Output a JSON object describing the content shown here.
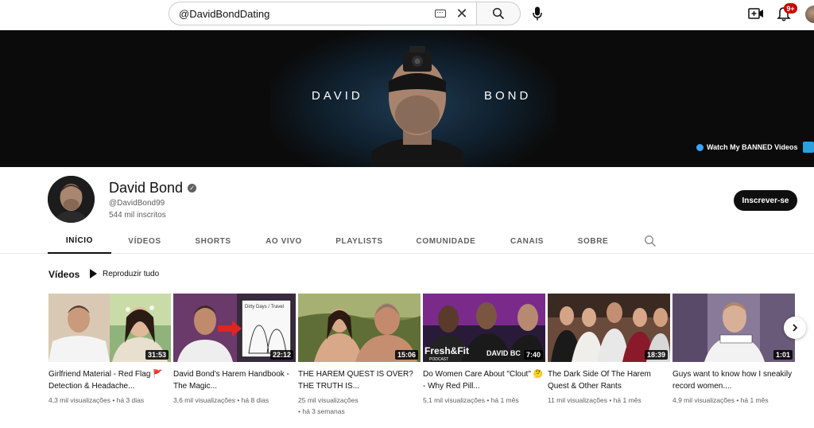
{
  "search": {
    "value": "@DavidBondDating"
  },
  "notifications": {
    "badge": "9+"
  },
  "banner": {
    "name_left": "DAVID",
    "name_right": "BOND",
    "link_label": "Watch My BANNED Videos"
  },
  "channel": {
    "name": "David Bond",
    "handle": "@DavidBond99",
    "subscribers": "544 mil inscritos",
    "subscribe_label": "Inscrever-se"
  },
  "tabs": [
    {
      "label": "INÍCIO",
      "active": true
    },
    {
      "label": "VÍDEOS"
    },
    {
      "label": "SHORTS"
    },
    {
      "label": "AO VIVO"
    },
    {
      "label": "PLAYLISTS"
    },
    {
      "label": "COMUNIDADE"
    },
    {
      "label": "CANAIS"
    },
    {
      "label": "SOBRE"
    }
  ],
  "section": {
    "title": "Vídeos",
    "play_all": "Reproduzir tudo"
  },
  "videos": [
    {
      "title": "Girlfriend Material - Red Flag 🚩Detection & Headache...",
      "views": "4,3 mil visualizações",
      "age": "há 3 dias",
      "duration": "31:53"
    },
    {
      "title": "David Bond's Harem Handbook - The Magic...",
      "views": "3,6 mil visualizações",
      "age": "há 8 dias",
      "duration": "22:12"
    },
    {
      "title": "THE HAREM QUEST IS OVER? THE TRUTH IS...",
      "views": "25 mil visualizações",
      "age": "há 3 semanas",
      "duration": "15:06"
    },
    {
      "title": "Do Women Care About \"Clout\" 🤔 - Why Red Pill...",
      "views": "5,1 mil visualizações",
      "age": "há 1 mês",
      "duration": "7:40"
    },
    {
      "title": "The Dark Side Of The Harem Quest & Other Rants",
      "views": "11 mil visualizações",
      "age": "há 1 mês",
      "duration": "18:39"
    },
    {
      "title": "Guys want to know how I sneakily record women....",
      "views": "4,9 mil visualizações",
      "age": "há 1 mês",
      "duration": "1:01"
    }
  ],
  "thumb_text": {
    "v2_sign": "Dirty Days / Travel",
    "v4_logo": "Fresh&Fit",
    "v4_sub": "PODCAST",
    "v4_name": "DAVID BC"
  }
}
